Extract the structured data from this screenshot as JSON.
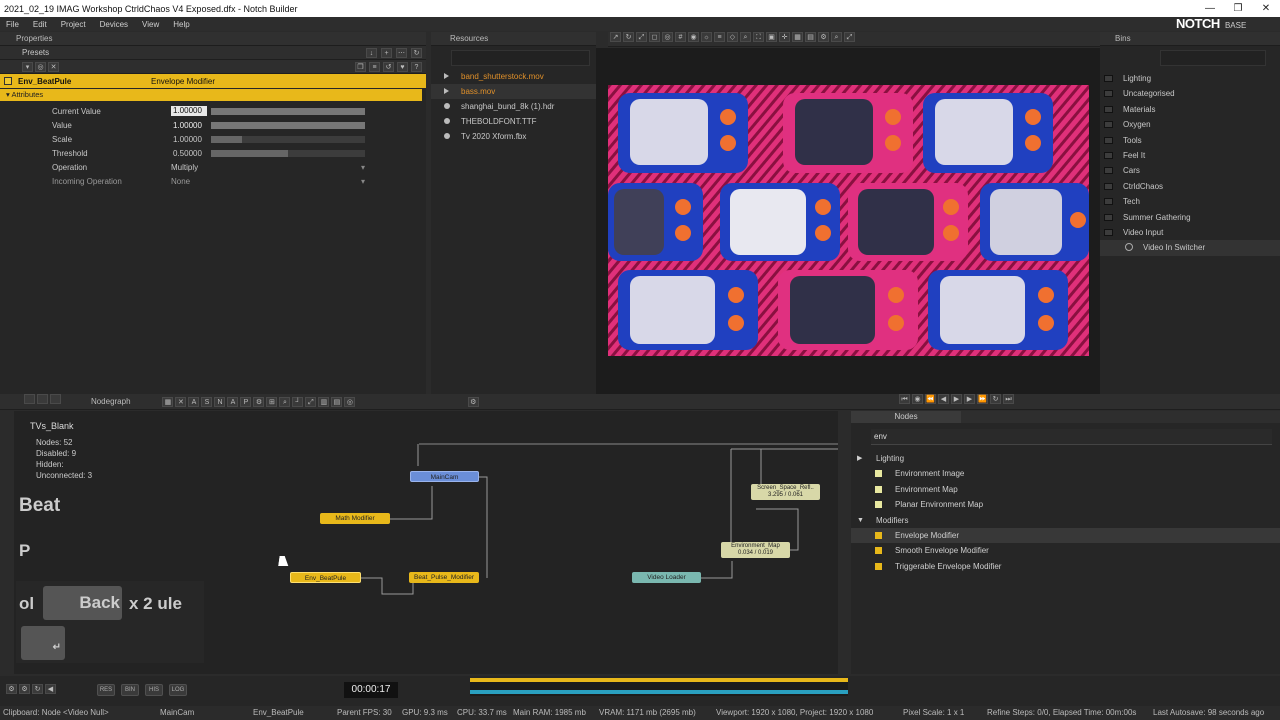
{
  "window": {
    "title": "2021_02_19 IMAG Workshop CtrldChaos V4 Exposed.dfx - Notch Builder"
  },
  "menu": [
    "File",
    "Edit",
    "Project",
    "Devices",
    "View",
    "Help"
  ],
  "logo": {
    "brand": "NOTCH",
    "edition": "BASE"
  },
  "properties": {
    "header": "Properties",
    "presets_label": "Presets",
    "node_name": "Env_BeatPule",
    "node_type": "Envelope Modifier",
    "section": "Attributes",
    "rows": [
      {
        "name": "Current Value",
        "value": "1.00000",
        "level": 1.0
      },
      {
        "name": "Value",
        "value": "1.00000",
        "level": 1.0
      },
      {
        "name": "Scale",
        "value": "1.00000",
        "level": 0.2
      },
      {
        "name": "Threshold",
        "value": "0.50000",
        "level": 0.5
      }
    ],
    "operation": {
      "name": "Operation",
      "value": "Multiply"
    },
    "incoming": {
      "name": "Incoming Operation",
      "value": "None"
    }
  },
  "resources": {
    "header": "Resources",
    "items": [
      {
        "label": "band_shutterstock.mov",
        "color": "#e0902a"
      },
      {
        "label": "bass.mov",
        "color": "#e0902a"
      },
      {
        "label": "shanghai_bund_8k (1).hdr",
        "color": "#c8c8c8"
      },
      {
        "label": "THEBOLDFONT.TTF",
        "color": "#c8c8c8"
      },
      {
        "label": "Tv 2020 Xform.fbx",
        "color": "#c8c8c8"
      }
    ]
  },
  "bins": {
    "header": "Bins",
    "items": [
      "Lighting",
      "Uncategorised",
      "Materials",
      "Oxygen",
      "Tools",
      "Feel It",
      "Cars",
      "CtrldChaos",
      "Tech",
      "Summer Gathering",
      "Video Input"
    ],
    "sub_item": "Video In Switcher"
  },
  "nodegraph": {
    "tab": "Nodegraph",
    "layer_name": "TVs_Blank",
    "stats": [
      "Nodes: 52",
      "Disabled: 9",
      "Hidden:",
      "Unconnected: 3"
    ],
    "nodes": {
      "main_cam": "MainCam",
      "math_mod": "Math Modifier",
      "env_beat": "Env_BeatPule",
      "beat_pulse": "Beat_Pulse_Modifier",
      "video_loader": "Video Loader",
      "env_map": "Environment_Map\n0.034 / 0.019",
      "screen_space": "Screen_Space_Refl..\n3.295 / 0.061"
    },
    "key_overlay": {
      "beat": "Beat",
      "p": "P",
      "ol": "ol",
      "back": "Back",
      "x2": "x 2 ule",
      "enter": "↵"
    }
  },
  "node_list": {
    "tab": "Nodes",
    "search": "env",
    "groups": [
      {
        "label": "Lighting",
        "items": [
          "Environment Image",
          "Environment Map",
          "Planar Environment Map"
        ]
      },
      {
        "label": "Modifiers",
        "items": [
          "Envelope Modifier",
          "Smooth Envelope Modifier",
          "Triggerable Envelope Modifier"
        ]
      }
    ]
  },
  "timeline": {
    "time": "00:00:17",
    "buttons": [
      "RES",
      "BIN",
      "HIS",
      "LOG"
    ]
  },
  "status": {
    "clipboard": "Clipboard: Node <Video Null>",
    "camera": "MainCam",
    "selected": "Env_BeatPule",
    "parent": "Parent FPS: 30",
    "gpu": "GPU: 9.3 ms",
    "cpu": "CPU: 33.7 ms",
    "ram": "Main RAM: 1985 mb",
    "vram": "VRAM: 1171 mb (2695 mb)",
    "viewport": "Viewport: 1920 x 1080, Project: 1920 x 1080",
    "pixel_scale": "Pixel Scale: 1 x 1",
    "refine": "Refine Steps: 0/0, Elapsed Time: 00m:00s",
    "autosave": "Last Autosave: 98 seconds ago"
  }
}
